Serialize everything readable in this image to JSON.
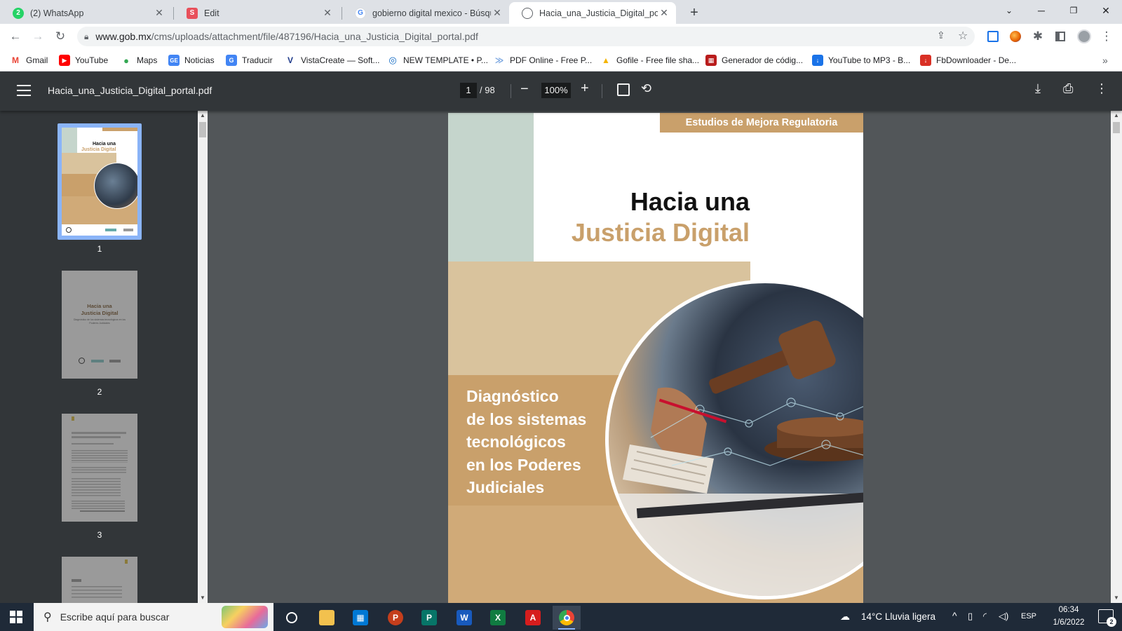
{
  "browser": {
    "tabs": [
      {
        "title": "(2) WhatsApp",
        "favicon": "whatsapp-icon",
        "badge": "2",
        "color": "#25d366"
      },
      {
        "title": "Edit",
        "favicon": "s-logo-icon",
        "badge": "S",
        "color": "#e8505b"
      },
      {
        "title": "gobierno digital mexico - Búsqueda",
        "favicon": "google-icon",
        "badge": "G",
        "color": "#4285f4"
      },
      {
        "title": "Hacia_una_Justicia_Digital_portal.pdf",
        "favicon": "globe-icon",
        "badge": "",
        "color": "#5f6368"
      }
    ],
    "url": {
      "host": "www.gob.mx",
      "path": "/cms/uploads/attachment/file/487196/Hacia_una_Justicia_Digital_portal.pdf"
    },
    "bookmarks": [
      {
        "label": "Gmail",
        "icon": "gmail-icon",
        "text": "M",
        "color": "#ea4335"
      },
      {
        "label": "YouTube",
        "icon": "youtube-icon",
        "text": "▶",
        "color": "#ff0000"
      },
      {
        "label": "Maps",
        "icon": "maps-pin-icon",
        "text": "●",
        "color": "#34a853"
      },
      {
        "label": "Noticias",
        "icon": "news-icon",
        "text": "GE",
        "color": "#4285f4"
      },
      {
        "label": "Traducir",
        "icon": "translate-icon",
        "text": "G",
        "color": "#4285f4"
      },
      {
        "label": "VistaCreate — Soft...",
        "icon": "vistacreate-icon",
        "text": "V",
        "color": "#1e3a8a"
      },
      {
        "label": "NEW TEMPLATE • P...",
        "icon": "template-icon",
        "text": "◎",
        "color": "#0a66c2"
      },
      {
        "label": "PDF Online - Free P...",
        "icon": "pdf-online-icon",
        "text": "≫",
        "color": "#7aa6e0"
      },
      {
        "label": "Gofile - Free file sha...",
        "icon": "gofile-icon",
        "text": "▲",
        "color": "#f4b400"
      },
      {
        "label": "Generador de códig...",
        "icon": "qr-icon",
        "text": "▦",
        "color": "#b91c1c"
      },
      {
        "label": "YouTube to MP3 - B...",
        "icon": "download-icon",
        "text": "↓",
        "color": "#1a73e8"
      },
      {
        "label": "FbDownloader - De...",
        "icon": "fb-download-icon",
        "text": "↓",
        "color": "#d93025"
      }
    ],
    "bookmarks_more": "»"
  },
  "pdf": {
    "filename": "Hacia_una_Justicia_Digital_portal.pdf",
    "page_current": "1",
    "page_total": "/ 98",
    "zoom": "100%",
    "thumbnails": [
      "1",
      "2",
      "3"
    ],
    "cover": {
      "tag": "Estudios de Mejora Regulatoria",
      "title_line1": "Hacia una",
      "title_line2": "Justicia Digital",
      "subtitle_lines": [
        "Diagnóstico",
        "de los sistemas",
        "tecnológicos",
        "en los Poderes",
        "Judiciales"
      ]
    },
    "thumb2": {
      "title1": "Hacia una",
      "title2": "Justicia Digital",
      "subtitle": "Diagnóstico de los sistemas tecnológicos en los Poderes Judiciales"
    }
  },
  "taskbar": {
    "search_placeholder": "Escribe aquí para buscar",
    "weather": "14°C  Lluvia ligera",
    "language": "ESP",
    "time": "06:34",
    "date": "1/6/2022",
    "notifications": "2"
  },
  "colors": {
    "tan": "#c9a06b",
    "sand": "#d9c39d",
    "sage": "#c5d5cc",
    "viewer_bg": "#525659",
    "toolbar_bg": "#323639"
  }
}
